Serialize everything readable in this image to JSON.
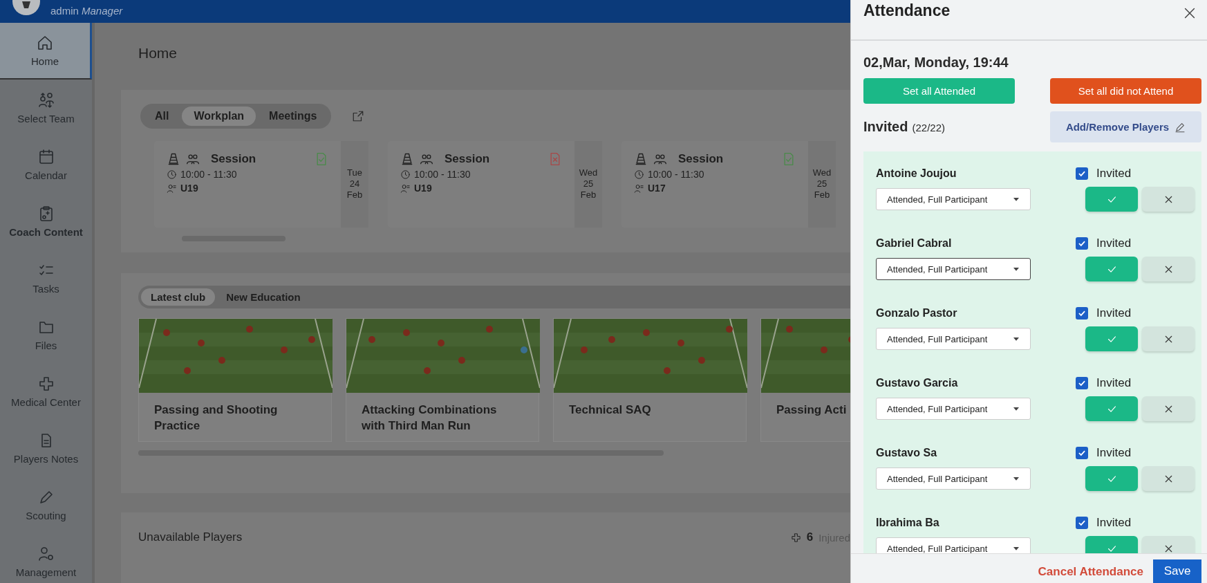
{
  "header": {
    "user_role": "admin *Manager*"
  },
  "sidebar": {
    "items": [
      {
        "label": "Home",
        "selected": true,
        "current": false
      },
      {
        "label": "Select Team",
        "selected": false,
        "current": false
      },
      {
        "label": "Calendar",
        "selected": false,
        "current": false
      },
      {
        "label": "Coach Content",
        "selected": false,
        "current": true
      },
      {
        "label": "Tasks",
        "selected": false,
        "current": false
      },
      {
        "label": "Files",
        "selected": false,
        "current": false
      },
      {
        "label": "Medical Center",
        "selected": false,
        "current": false
      },
      {
        "label": "Players Notes",
        "selected": false,
        "current": false
      },
      {
        "label": "Scouting",
        "selected": false,
        "current": false
      },
      {
        "label": "Management",
        "selected": false,
        "current": false
      }
    ]
  },
  "page_title": "Home",
  "schedule": {
    "filters": [
      {
        "label": "All",
        "selected": false
      },
      {
        "label": "Workplan",
        "selected": true
      },
      {
        "label": "Meetings",
        "selected": false
      }
    ],
    "events": [
      {
        "title": "Session",
        "time": "10:00 - 11:30",
        "team": "U19",
        "kind": "ok",
        "weekday": "Tue",
        "day": "24",
        "month": "Feb"
      },
      {
        "title": "Session",
        "time": "10:00 - 11:30",
        "team": "U19",
        "kind": "missing",
        "weekday": "Wed",
        "day": "25",
        "month": "Feb"
      },
      {
        "title": "Session",
        "time": "10:00 - 11:30",
        "team": "U17",
        "kind": "ok",
        "weekday": "Wed",
        "day": "25",
        "month": "Feb"
      }
    ]
  },
  "content": {
    "tabs": [
      {
        "label": "Latest club",
        "selected": true
      },
      {
        "label": "New Education",
        "selected": false
      }
    ],
    "drills": [
      {
        "title": "Passing and Shooting Practice",
        "kind": "picture"
      },
      {
        "title": "Attacking Combinations with Third Man Run",
        "kind": "picture"
      },
      {
        "title": "Technical SAQ",
        "kind": "picture"
      },
      {
        "title": "Passing Acti",
        "kind": "picture"
      }
    ]
  },
  "unavailable": {
    "title": "Unavailable Players",
    "count": "6",
    "label": "Injured"
  },
  "attendance": {
    "title": "Attendance",
    "date": "02,Mar, Monday, 19:44",
    "set_all_attended": "Set all Attended",
    "set_all_not": "Set all did not Attend",
    "invited_label": "Invited",
    "invited_count": "(22/22)",
    "add_remove": "Add/Remove Players",
    "players": [
      {
        "name": "Antoine Joujou",
        "invited": true,
        "invited_label": "Invited",
        "status": "Attended, Full Participant",
        "focused": false,
        "attended": true
      },
      {
        "name": "Gabriel Cabral",
        "invited": true,
        "invited_label": "Invited",
        "status": "Attended, Full Participant",
        "focused": true,
        "attended": true
      },
      {
        "name": "Gonzalo Pastor",
        "invited": true,
        "invited_label": "Invited",
        "status": "Attended, Full Participant",
        "focused": false,
        "attended": true
      },
      {
        "name": "Gustavo Garcia",
        "invited": true,
        "invited_label": "Invited",
        "status": "Attended, Full Participant",
        "focused": false,
        "attended": true
      },
      {
        "name": "Gustavo Sa",
        "invited": true,
        "invited_label": "Invited",
        "status": "Attended, Full Participant",
        "focused": false,
        "attended": true
      },
      {
        "name": "Ibrahima Ba",
        "invited": true,
        "invited_label": "Invited",
        "status": "Attended, Full Participant",
        "focused": false,
        "attended": true
      }
    ],
    "cancel": "Cancel Attendance",
    "save": "Save"
  }
}
